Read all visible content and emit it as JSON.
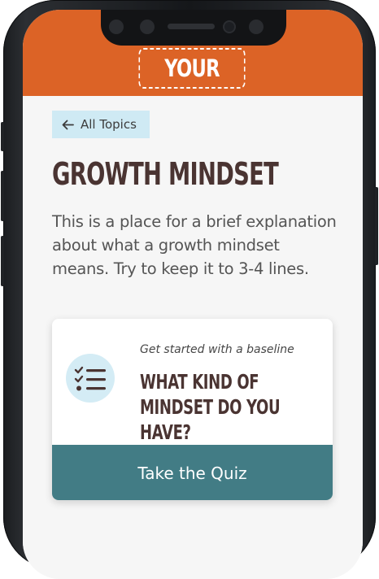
{
  "header": {
    "logo_text": "YOUR LOGO",
    "background_color": "#dc6326"
  },
  "nav": {
    "back_label": "All Topics",
    "back_icon": "arrow-left-icon"
  },
  "topic": {
    "title": "GROWTH MINDSET",
    "description": "This is a place for a brief explanation about what a growth mindset means. Try to keep it to 3-4 lines."
  },
  "quiz_card": {
    "icon": "checklist-icon",
    "kicker": "Get started with a baseline",
    "question": "WHAT KIND OF MINDSET DO YOU HAVE?",
    "button_label": "Take the Quiz",
    "button_color": "#427c85"
  }
}
